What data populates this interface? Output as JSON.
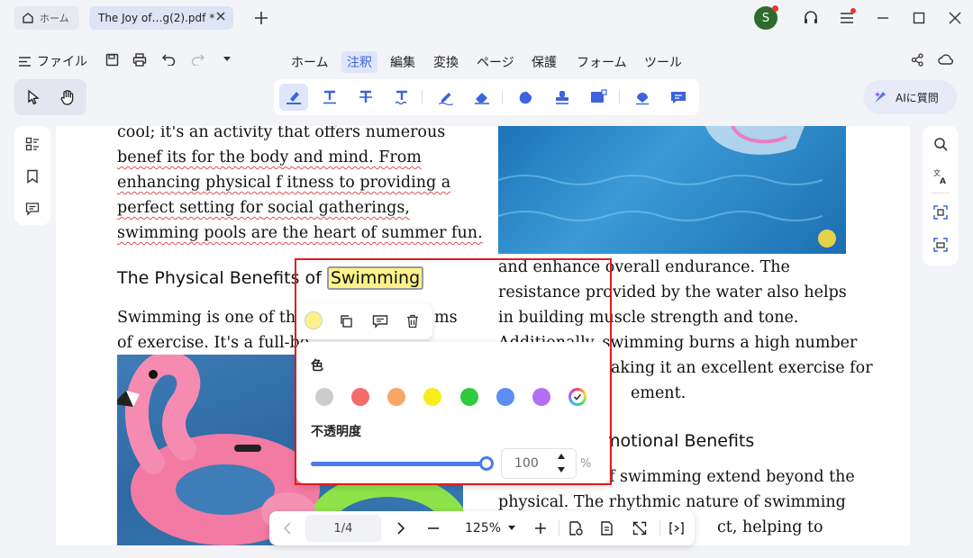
{
  "tabs": {
    "home_label": "ホーム",
    "doc_title": "The Joy of…g(2).pdf *"
  },
  "avatar_letter": "S",
  "menu": {
    "file_label": "ファイル",
    "items": [
      "ホーム",
      "注釈",
      "編集",
      "変換",
      "ページ",
      "保護",
      "フォーム",
      "ツール"
    ]
  },
  "ai_button": "AIに質問",
  "document": {
    "left_lines": [
      "cool; it's an activity that offers numerous",
      "benef  its for the body and mind. From",
      "enhancing physical f  itness to providing a",
      "perfect setting for social gatherings,",
      "swimming pools are the heart of summer fun."
    ],
    "heading_prefix": "The Physical Benefits of ",
    "heading_highlight": "Swimming",
    "left_lines2": [
      "Swimming is one of the",
      "of exercise. It's a full-bo"
    ],
    "left_lines2_tail": [
      "ms",
      ""
    ],
    "right_lines": [
      "and enhance overall endurance. The",
      "resistance provided by the water also helps",
      "in building muscle strength and tone.",
      "Additionally, swimming burns a high number",
      "aking it an excellent exercise for",
      "ement."
    ],
    "right_heading": "motional Benefits",
    "right_lines2": [
      "f swimming extend beyond the",
      "physical. The rhythmic nature of swimming",
      "ct, helping to"
    ]
  },
  "popup": {
    "color_label": "色",
    "opacity_label": "不透明度",
    "opacity_value": "100",
    "percent": "%",
    "swatches": [
      "#cccccc",
      "#f36b6b",
      "#f8a765",
      "#f8ec1e",
      "#2ecb3f",
      "#5b8df5",
      "#b46ef5",
      "rainbow-selected"
    ]
  },
  "bottom_bar": {
    "page": "1/4",
    "zoom": "125%"
  }
}
